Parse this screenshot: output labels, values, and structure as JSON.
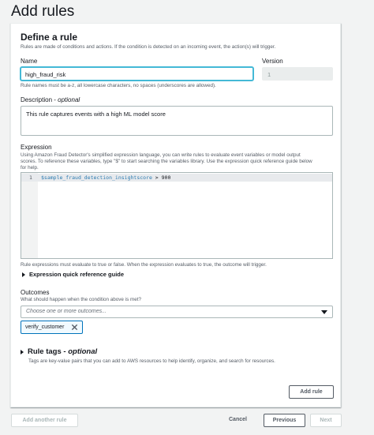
{
  "page": {
    "title": "Add rules"
  },
  "card": {
    "title": "Define a rule",
    "description": "Rules are made of conditions and actions. If the condition is detected on an incoming event, the action(s) will trigger."
  },
  "name_field": {
    "label": "Name",
    "value": "high_fraud_risk",
    "hint": "Rule names must be a-z, all lowercase characters, no spaces (underscores are allowed)."
  },
  "version_field": {
    "label": "Version",
    "value": "1"
  },
  "description_field": {
    "label": "Description",
    "label_suffix": "optional",
    "value": "This rule captures events with a high ML model score"
  },
  "expression": {
    "label": "Expression",
    "hint_line1": "Using Amazon Fraud Detector's simplified expression language, you can write rules to evaluate event variables or model output",
    "hint_line2": "scores. To reference these variables, type \"$\" to start searching the variables library. Use the expression quick reference guide below",
    "hint_line3": "for help.",
    "line_number": "1",
    "code_var": "$sample_fraud_detection_insightscore",
    "code_op": " > ",
    "code_value": "900",
    "footer_hint": "Rule expressions must evaluate to true or false. When the expression evaluates to true, the outcome will trigger.",
    "quick_ref_label": "Expression quick reference guide"
  },
  "outcomes": {
    "label": "Outcomes",
    "hint": "What should happen when the condition above is met?",
    "placeholder": "Choose one or more outcomes...",
    "selected": [
      "verify_customer"
    ]
  },
  "rule_tags": {
    "title": "Rule tags",
    "title_suffix": "optional",
    "hint": "Tags are key-value pairs that you can add to AWS resources to help identify, organize, and search for resources."
  },
  "buttons": {
    "add_rule": "Add rule",
    "add_another_rule": "Add another rule",
    "cancel": "Cancel",
    "previous": "Previous",
    "next": "Next"
  },
  "colors": {
    "accent": "#0073bb",
    "focus": "#44b9d6",
    "background": "#f2f3f3"
  }
}
